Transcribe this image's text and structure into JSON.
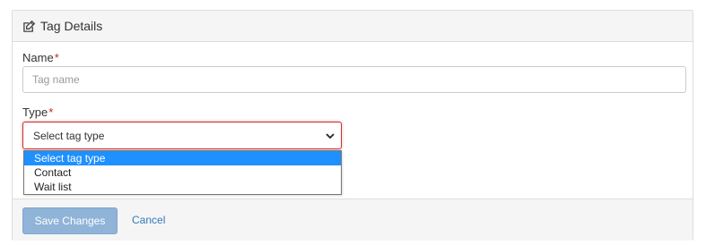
{
  "panel": {
    "title": "Tag Details",
    "title_icon": "edit-icon"
  },
  "form": {
    "name": {
      "label": "Name",
      "required_marker": "*",
      "placeholder": "Tag name",
      "value": ""
    },
    "type": {
      "label": "Type",
      "required_marker": "*",
      "selected_value": "Select tag type",
      "options": [
        "Select tag type",
        "Contact",
        "Wait list"
      ],
      "highlighted_option": "Select tag type"
    }
  },
  "footer": {
    "save_label": "Save Changes",
    "cancel_label": "Cancel"
  },
  "colors": {
    "required": "#cc2222",
    "select_error_border": "#c9302c",
    "option_highlight": "#1e90ff",
    "save_button_disabled": "#8fb4d8",
    "link": "#337ab7"
  }
}
